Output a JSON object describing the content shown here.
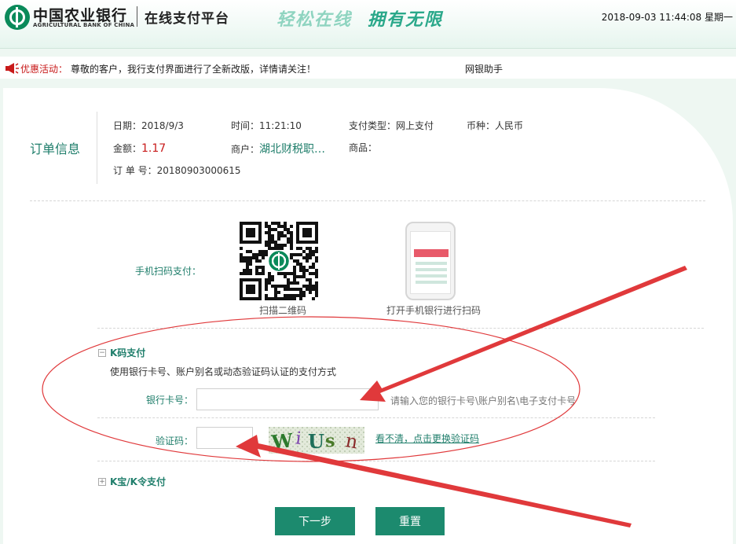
{
  "header": {
    "bank_name_cn": "中国农业银行",
    "bank_name_en": "AGRICULTURAL BANK OF CHINA",
    "platform_title": "在线支付平台",
    "slogan_part1": "轻松在线",
    "slogan_part2": "拥有无限",
    "datetime": "2018-09-03 11:44:08 星期一"
  },
  "notice": {
    "label": "优惠活动：",
    "text": "尊敬的客户，我行支付界面进行了全新改版，详情请关注！",
    "helper_link": "网银助手"
  },
  "order": {
    "title": "订单信息",
    "date_label": "日期：",
    "date_value": "2018/9/3",
    "time_label": "时间：",
    "time_value": "11:21:10",
    "pay_type_label": "支付类型：",
    "pay_type_value": "网上支付",
    "currency_label": "币种：",
    "currency_value": "人民币",
    "amount_label": "金额：",
    "amount_value": "1.17",
    "merchant_label": "商户：",
    "merchant_value": "湖北财税职…",
    "goods_label": "商品：",
    "order_no_label": "订 单 号：",
    "order_no_value": "20180903000615"
  },
  "mobile_pay": {
    "label": "手机扫码支付：",
    "qr_caption": "扫描二维码",
    "phone_caption": "打开手机银行进行扫码"
  },
  "kcode": {
    "toggle": "−",
    "title": "K码支付",
    "description": "使用银行卡号、账户别名或动态验证码认证的支付方式",
    "card_label": "银行卡号：",
    "card_value": "",
    "card_hint": "请输入您的银行卡号\\账户别名\\电子支付卡号",
    "captcha_label": "验证码：",
    "captcha_value": "",
    "captcha_text": "WiUsn",
    "refresh_link": "看不清，点击更换验证码"
  },
  "kbao": {
    "toggle": "+",
    "title": "K宝/K令支付"
  },
  "buttons": {
    "next": "下一步",
    "reset": "重置"
  },
  "colors": {
    "brand_green": "#1c8a6e",
    "text_green": "#1f7e6b",
    "alert_red": "#c81a1a",
    "annotation_red": "#e0393b"
  }
}
